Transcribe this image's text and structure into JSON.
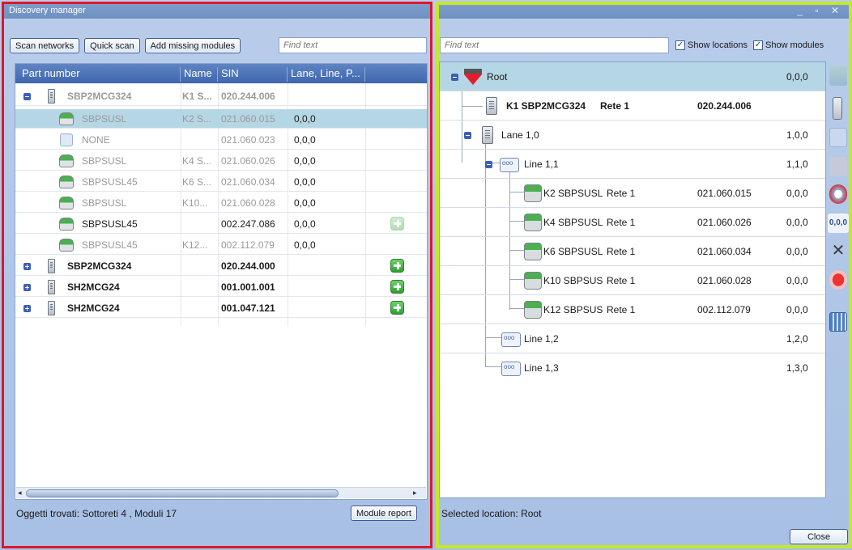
{
  "left": {
    "title": "Discovery manager",
    "toolbar": {
      "scan_networks": "Scan networks",
      "quick_scan": "Quick scan",
      "add_missing": "Add missing modules",
      "find_placeholder": "Find text"
    },
    "columns": {
      "part_number": "Part number",
      "name": "Name",
      "sin": "SIN",
      "lane": "Lane, Line, P..."
    },
    "rows": [
      {
        "part": "SBP2MCG324",
        "name": "K1 S...",
        "sin": "020.244.006",
        "lane": "",
        "style": "gray bold"
      },
      {
        "part": "SBPSUSL",
        "name": "K2 S...",
        "sin": "021.060.015",
        "lane": "0,0,0",
        "style": "gray"
      },
      {
        "part": "NONE",
        "name": "",
        "sin": "021.060.023",
        "lane": "0,0,0",
        "style": "gray"
      },
      {
        "part": "SBPSUSL",
        "name": "K4 S...",
        "sin": "021.060.026",
        "lane": "0,0,0",
        "style": "gray"
      },
      {
        "part": "SBPSUSL45",
        "name": "K6 S...",
        "sin": "021.060.034",
        "lane": "0,0,0",
        "style": "gray"
      },
      {
        "part": "SBPSUSL",
        "name": "K10...",
        "sin": "021.060.028",
        "lane": "0,0,0",
        "style": "gray"
      },
      {
        "part": "SBPSUSL45",
        "name": "",
        "sin": "002.247.086",
        "lane": "0,0,0",
        "style": ""
      },
      {
        "part": "SBPSUSL45",
        "name": "K12...",
        "sin": "002.112.079",
        "lane": "0,0,0",
        "style": "gray"
      },
      {
        "part": "SBP2MCG324",
        "name": "",
        "sin": "020.244.000",
        "lane": "",
        "style": "bold"
      },
      {
        "part": "SH2MCG24",
        "name": "",
        "sin": "001.001.001",
        "lane": "",
        "style": "bold"
      },
      {
        "part": "SH2MCG24",
        "name": "",
        "sin": "001.047.121",
        "lane": "",
        "style": "bold"
      }
    ],
    "status": "Oggetti trovati: Sottoreti 4 , Moduli 17",
    "module_report": "Module report"
  },
  "right": {
    "find_placeholder": "Find text",
    "show_locations": "Show locations",
    "show_modules": "Show modules",
    "tree": {
      "root": {
        "label": "Root",
        "addr": "0,0,0"
      },
      "k1": {
        "label": "K1 SBP2MCG324",
        "net": "Rete 1",
        "sin": "020.244.006"
      },
      "lane": {
        "label": "Lane 1,0",
        "addr": "1,0,0"
      },
      "line11": {
        "label": "Line 1,1",
        "addr": "1,1,0"
      },
      "modules": [
        {
          "label": "K2 SBPSUSL",
          "net": "Rete 1",
          "sin": "021.060.015",
          "addr": "0,0,0"
        },
        {
          "label": "K4 SBPSUSL",
          "net": "Rete 1",
          "sin": "021.060.026",
          "addr": "0,0,0"
        },
        {
          "label": "K6 SBPSUSL",
          "net": "Rete 1",
          "sin": "021.060.034",
          "addr": "0,0,0"
        },
        {
          "label": "K10 SBPSUS",
          "net": "Rete 1",
          "sin": "021.060.028",
          "addr": "0,0,0"
        },
        {
          "label": "K12 SBPSUS",
          "net": "Rete 1",
          "sin": "002.112.079",
          "addr": "0,0,0"
        }
      ],
      "line12": {
        "label": "Line 1,2",
        "addr": "1,2,0"
      },
      "line13": {
        "label": "Line 1,3",
        "addr": "1,3,0"
      }
    },
    "tool_badge": "0,0,0",
    "status": "Selected location: Root",
    "close": "Close"
  }
}
